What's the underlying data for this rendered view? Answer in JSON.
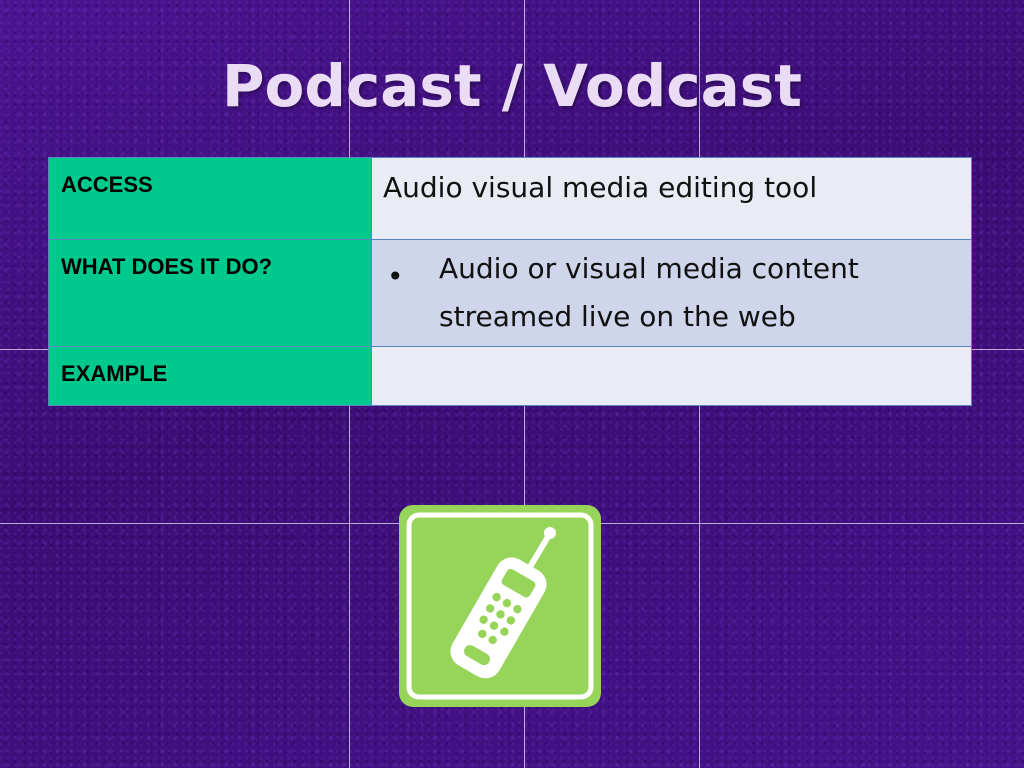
{
  "slide": {
    "title": "Podcast / Vodcast"
  },
  "table": {
    "rows": [
      {
        "label": "ACCESS",
        "value": "Audio visual media editing tool"
      },
      {
        "label": "WHAT DOES IT DO?",
        "bullets": [
          "Audio or visual media content streamed live on the web"
        ]
      },
      {
        "label": "EXAMPLE",
        "value": ""
      }
    ],
    "bullet_glyph": "•"
  },
  "icon": {
    "name": "mobile-phone-icon",
    "tile_color": "#96d45a"
  },
  "colors": {
    "background": "#3e0f78",
    "title": "#eadcf5",
    "label_cell": "#00c98d",
    "value_cell_light": "#e9ebf5",
    "value_cell_dark": "#cfd5ea"
  }
}
